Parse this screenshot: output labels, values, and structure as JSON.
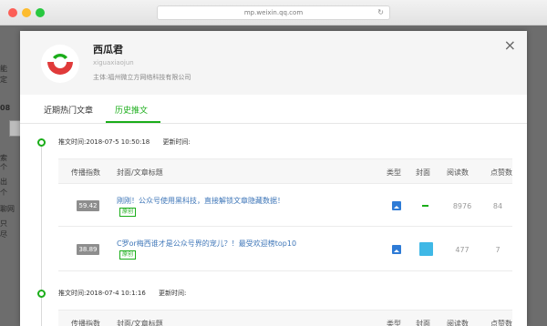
{
  "browser": {
    "url": "mp.weixin.qq.com",
    "reload_glyph": "↻"
  },
  "background_fragments": [
    "能",
    "定",
    "08",
    "索",
    "个",
    "出",
    "个",
    "聊网",
    "只",
    "尽"
  ],
  "account": {
    "name": "西瓜君",
    "wechat_id": "xiguaxiaojun",
    "owner": "主体:福州微立方网络科技有限公司",
    "close_glyph": "×",
    "logo_colors": {
      "red": "#e03a3a",
      "green": "#1aad19"
    }
  },
  "tabs": [
    {
      "label": "近期热门文章",
      "active": false
    },
    {
      "label": "历史推文",
      "active": true
    }
  ],
  "columns": {
    "spread": "传播指数",
    "cover_title": "封面/文章标题",
    "type": "类型",
    "cover": "封面",
    "reads": "阅读数",
    "likes": "点赞数"
  },
  "groups": [
    {
      "push_time_label": "推文时间:",
      "push_time": "2018-07-5 10:50:18",
      "update_time_label": "更新时间:",
      "articles": [
        {
          "spread": "59.42",
          "title": "刚刚！公众号使用黑科技，直接解锁文章隐藏数据！",
          "badge": "原创",
          "type_icon": "image-icon",
          "cover": "dash",
          "reads": "8976",
          "likes": "84"
        },
        {
          "spread": "38.89",
          "title": "C罗or梅西谁才是公众号界的宠儿？！最受欢迎榜top10",
          "badge": "原创",
          "type_icon": "image-icon",
          "cover": "thumbnail",
          "reads": "477",
          "likes": "7"
        }
      ]
    },
    {
      "push_time_label": "推文时间:",
      "push_time": "2018-07-4 10:1:16",
      "update_time_label": "更新时间:",
      "articles": []
    }
  ]
}
